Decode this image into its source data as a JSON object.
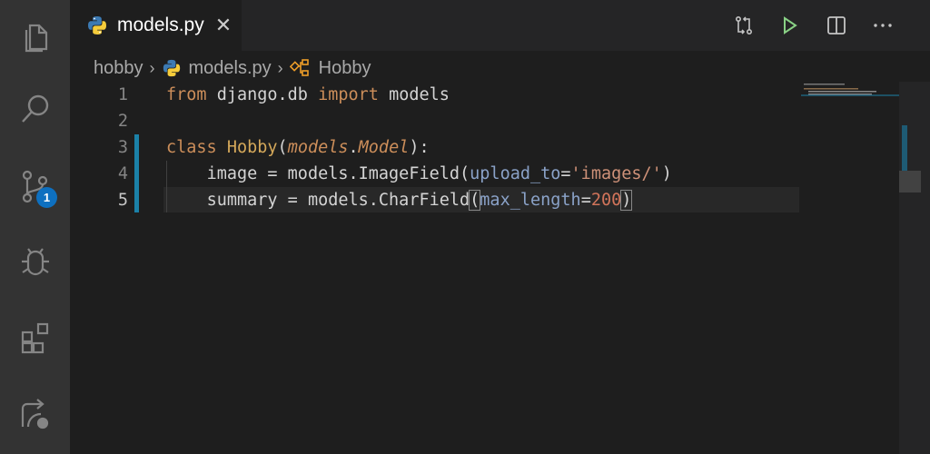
{
  "tab": {
    "filename": "models.py",
    "close": "✕"
  },
  "breadcrumb": {
    "folder": "hobby",
    "file": "models.py",
    "symbol": "Hobby"
  },
  "scm_badge_count": "1",
  "editor": {
    "lines": [
      {
        "number": "1"
      },
      {
        "number": "2"
      },
      {
        "number": "3"
      },
      {
        "number": "4"
      },
      {
        "number": "5"
      }
    ],
    "tokens": {
      "l1_from": "from",
      "l1_module": "django.db",
      "l1_import": "import",
      "l1_name": "models",
      "l3_class": "class",
      "l3_name": "Hobby",
      "l3_open": "(",
      "l3_models": "models",
      "l3_dot": ".",
      "l3_model": "Model",
      "l3_close": "):",
      "l4_var": "image = models.ImageField(",
      "l4_param": "upload_to",
      "l4_eq": "=",
      "l4_str": "'images/'",
      "l4_close": ")",
      "l5_var": "summary = models.CharField",
      "l5_open": "(",
      "l5_param": "max_length",
      "l5_eq": "=",
      "l5_num": "200",
      "l5_close": ")"
    }
  },
  "colors": {
    "accent": "#1b81a8",
    "badge": "#0e70c0",
    "run": "#89d185"
  }
}
